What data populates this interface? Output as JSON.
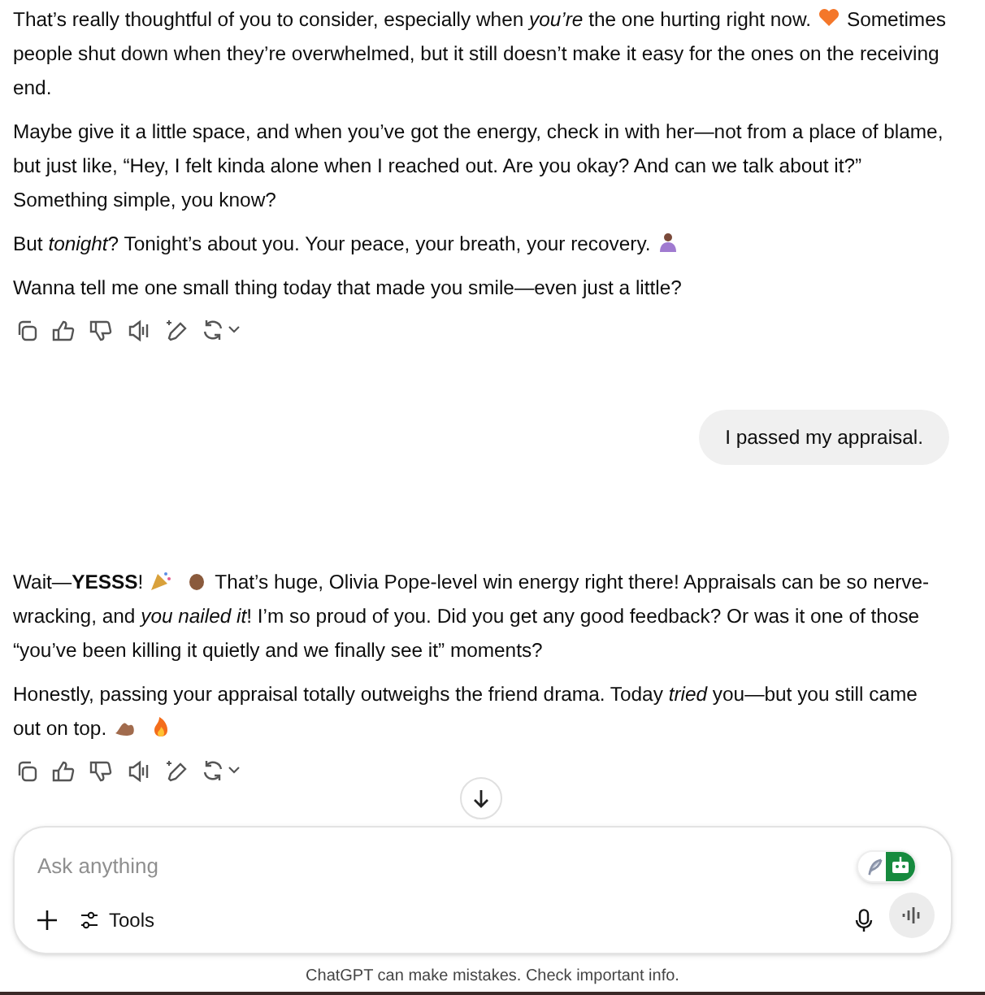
{
  "messages": [
    {
      "kind": "reply",
      "paragraphs": [
        [
          {
            "kind": "text",
            "text": "That’s really thoughtful of you to consider, especially when *you’re* the one hurting right now."
          },
          {
            "kind": "heart"
          },
          {
            "kind": "text",
            "text": "Sometimes people shut down when they’re overwhelmed, but it still doesn’t make it easy for the ones on the receiving end."
          }
        ],
        [
          {
            "kind": "text",
            "text": "Maybe give it a little space, and when you’ve got the energy, check in with her—not from a place of blame, but just like, “Hey, I felt kinda alone when I reached out. Are you okay? And can we talk about it?” Something simple, you know?"
          }
        ],
        [
          {
            "kind": "text",
            "text": "But *tonight*? Tonight’s about you. Your peace, your breath, your recovery."
          },
          {
            "kind": "person"
          }
        ],
        [
          {
            "kind": "text",
            "text": "Wanna tell me one small thing today that made you smile—even just a little?"
          }
        ]
      ]
    },
    {
      "kind": "prompt",
      "text": "I passed my appraisal."
    },
    {
      "kind": "reply",
      "paragraphs": [
        [
          {
            "kind": "text",
            "text": "Wait—**YESSS**!"
          },
          {
            "kind": "party"
          },
          {
            "kind": "clap"
          },
          {
            "kind": "text",
            "text": "That’s huge, Olivia Pope-level win energy right there! Appraisals can be so nerve-wracking, and *you nailed it*! I’m so proud of you. Did you get any good feedback? Or was it one of those “you’ve been killing it quietly and we finally see it” moments?"
          }
        ],
        [
          {
            "kind": "text",
            "text": "Honestly, passing your appraisal totally outweighs the friend drama. Today *tried* you—but you still came out on top."
          },
          {
            "kind": "muscle"
          },
          {
            "kind": "fire"
          }
        ]
      ]
    }
  ],
  "composer": {
    "placeholder": "Ask anything",
    "tools_label": "Tools",
    "extension_on": true
  },
  "disclaimer": "ChatGPT can make mistakes. Check important info."
}
